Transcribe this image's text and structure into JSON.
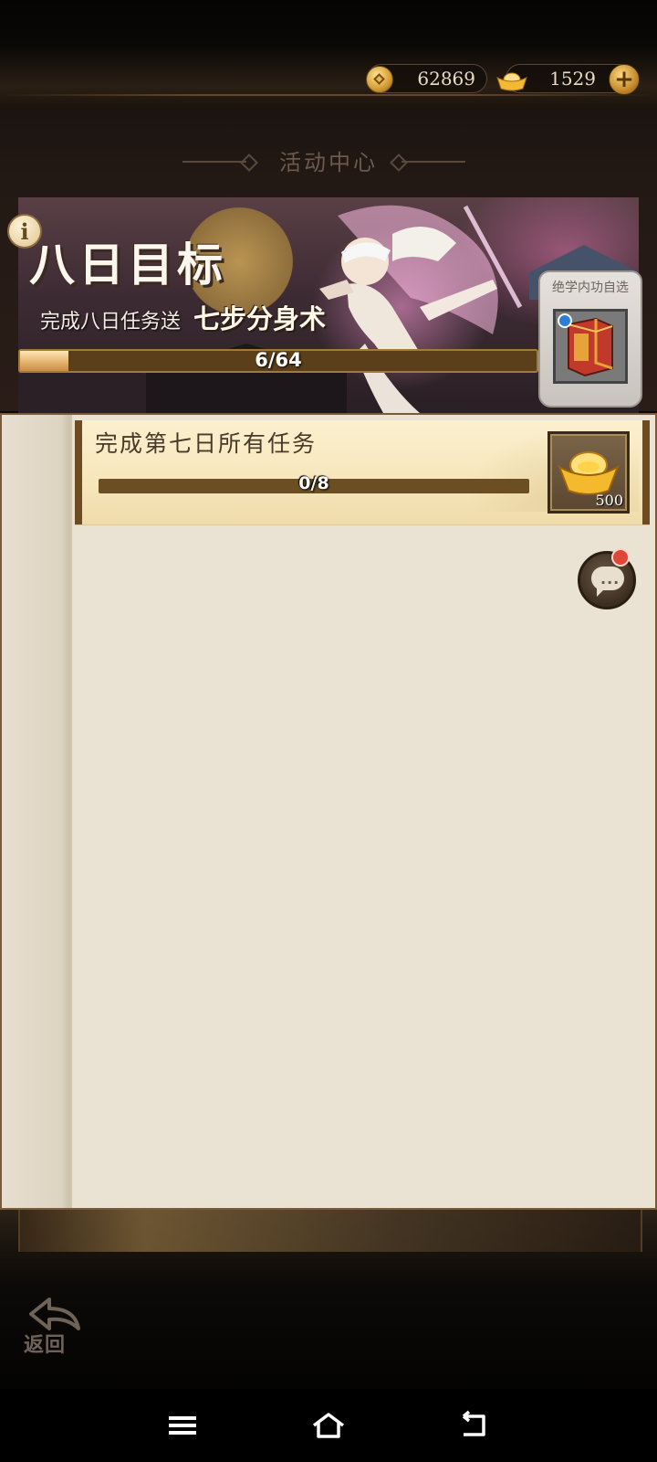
{
  "currency": {
    "coins": "62869",
    "ingots": "1529"
  },
  "section_title": "活动中心",
  "event": {
    "title": "八日目标",
    "subtitle": "完成八日任务送",
    "reward_name": "七步分身术",
    "progress_text": "6/64",
    "progress_fraction": 0.094,
    "reward_card_label": "绝学内功自选"
  },
  "task": {
    "title": "完成第七日所有任务",
    "progress_text": "0/8",
    "progress_fraction": 0,
    "reward_count": "500"
  },
  "back_label": "返回",
  "colors": {
    "accent_gold": "#e2b06b",
    "panel_bg": "#eae3d4",
    "notify_red": "#e0463a"
  },
  "icons": [
    "coin-icon",
    "gold-ingot-icon",
    "plus-icon",
    "info-icon",
    "chat-icon",
    "back-arrow-icon",
    "menu-icon",
    "home-icon",
    "nav-back-icon"
  ]
}
